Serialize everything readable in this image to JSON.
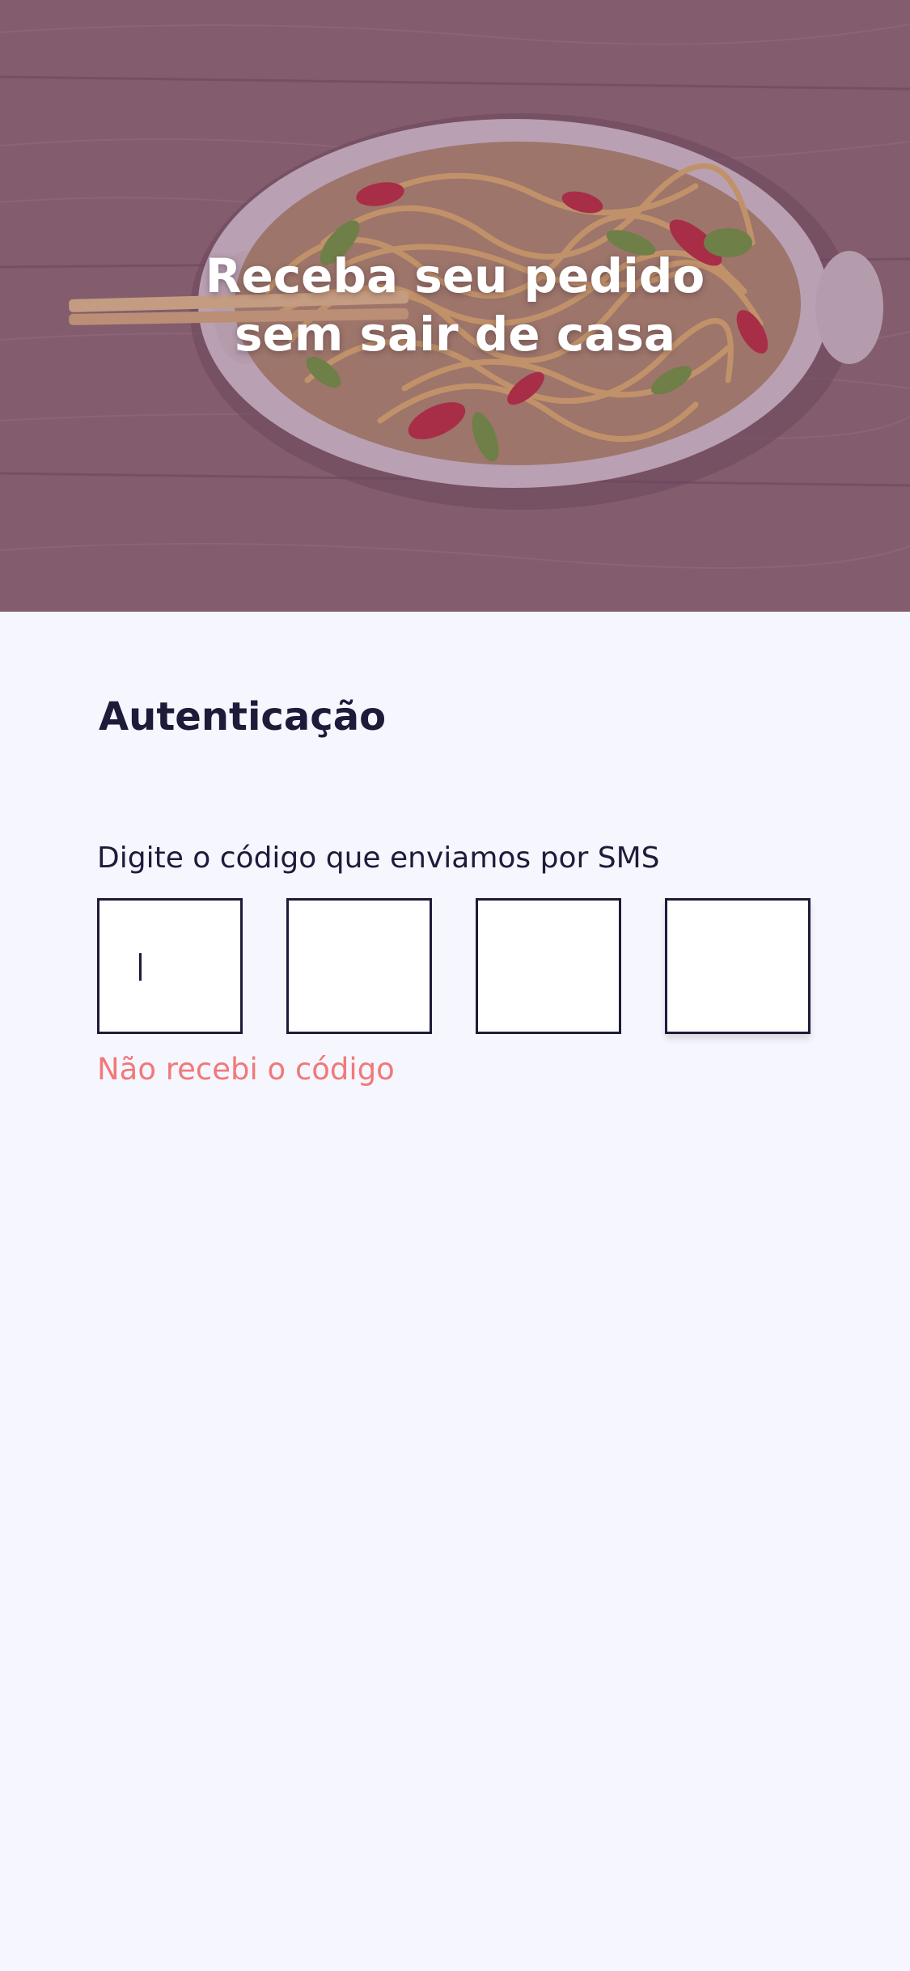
{
  "hero": {
    "title": "Receba seu pedido\nsem sair de casa",
    "image": "noodle-bowl-with-chopsticks"
  },
  "auth": {
    "title": "Autenticação",
    "instruction": "Digite o código que enviamos por SMS",
    "code_fields": [
      {
        "value": "",
        "focused": true
      },
      {
        "value": "",
        "focused": false
      },
      {
        "value": "",
        "focused": false
      },
      {
        "value": "",
        "focused": false
      }
    ],
    "resend_link": "Não recebi o código"
  },
  "colors": {
    "background": "#F6F6FE",
    "text_dark": "#1E1B3A",
    "accent": "#F0797A",
    "hero_overlay": "#6B3B6B"
  }
}
